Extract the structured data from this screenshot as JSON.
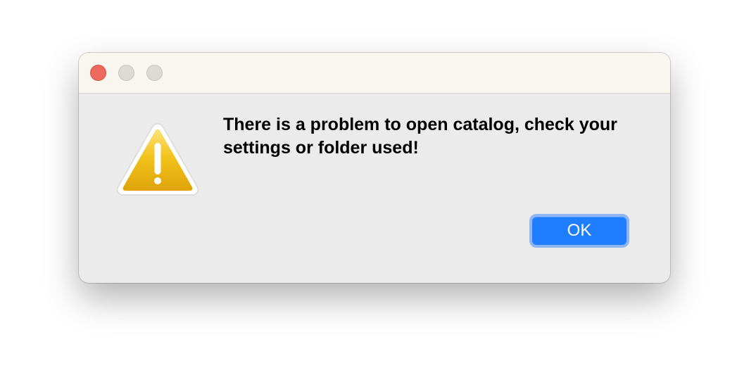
{
  "dialog": {
    "message": "There is a problem to open catalog, check your settings or folder used!",
    "ok_label": "OK",
    "icon": "warning-icon"
  },
  "titlebar": {
    "buttons": [
      "close-button",
      "minimize-button",
      "zoom-button"
    ]
  },
  "colors": {
    "accent": "#1f7eff",
    "close_light": "#ee6a5e",
    "warning_yellow": "#f2c21b"
  }
}
